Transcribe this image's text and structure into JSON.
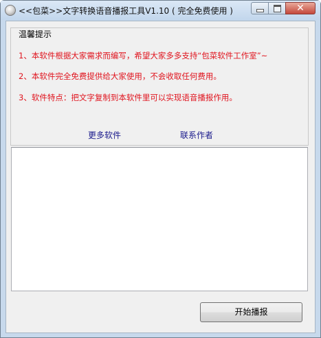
{
  "window": {
    "title": "<<包菜>>文字转换语音播报工具V1.10 ( 完全免费使用 )",
    "close_symbol": "✕"
  },
  "notice": {
    "group_title": "温馨提示",
    "lines": [
      "1、本软件根据大家需求而编写，希望大家多多支持“包菜软件工作室”~",
      "2、本软件完全免费提供给大家使用，不会收取任何费用。",
      "3、软件特点：把文字复制到本软件里可以实现语音播报作用。"
    ],
    "color": "#e0141e"
  },
  "links": {
    "more_software": "更多软件",
    "contact_author": "联系作者"
  },
  "text_input": {
    "value": ""
  },
  "buttons": {
    "start_play": "开始播报"
  }
}
